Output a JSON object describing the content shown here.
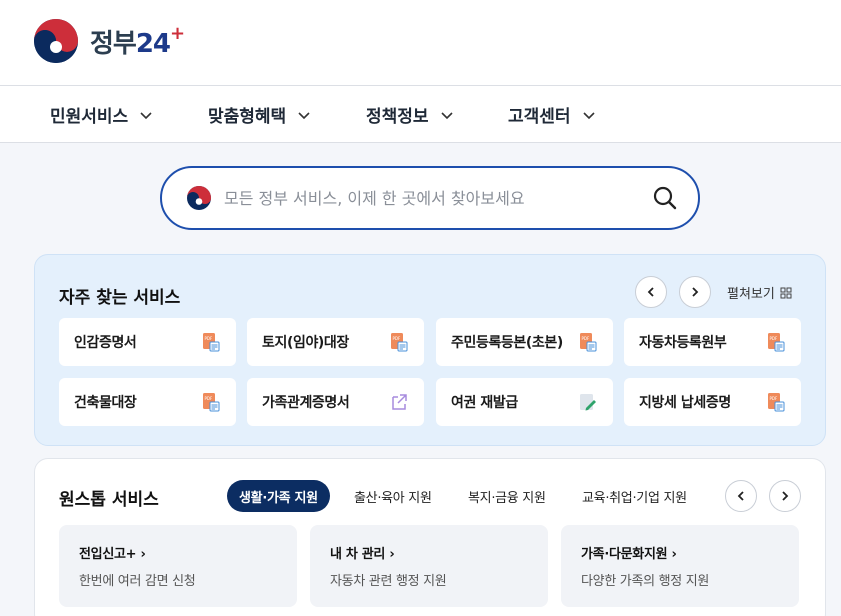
{
  "header": {
    "logo_text": "정부",
    "logo_num": "24",
    "logo_plus": "+"
  },
  "nav": {
    "items": [
      {
        "label": "민원서비스"
      },
      {
        "label": "맞춤형혜택"
      },
      {
        "label": "정책정보"
      },
      {
        "label": "고객센터"
      }
    ]
  },
  "search": {
    "placeholder": "모든 정부 서비스, 이제 한 곳에서 찾아보세요",
    "value": ""
  },
  "frequent": {
    "title": "자주 찾는 서비스",
    "expand_label": "펼쳐보기",
    "services": [
      {
        "label": "인감증명서",
        "icon": "pdf-doc-icon"
      },
      {
        "label": "토지(임야)대장",
        "icon": "pdf-doc-icon"
      },
      {
        "label": "주민등록등본(초본)",
        "icon": "pdf-doc-icon"
      },
      {
        "label": "자동차등록원부",
        "icon": "pdf-doc-icon"
      },
      {
        "label": "건축물대장",
        "icon": "pdf-doc-icon"
      },
      {
        "label": "가족관계증명서",
        "icon": "external-link-icon"
      },
      {
        "label": "여권 재발급",
        "icon": "edit-doc-icon"
      },
      {
        "label": "지방세 납세증명",
        "icon": "pdf-doc-icon"
      }
    ]
  },
  "onestop": {
    "title": "원스톱 서비스",
    "tabs": [
      {
        "label": "생활·가족 지원",
        "active": true
      },
      {
        "label": "출산·육아 지원"
      },
      {
        "label": "복지·금융 지원"
      },
      {
        "label": "교육·취업·기업 지원"
      }
    ],
    "cards": [
      {
        "title": "전입신고+ ›",
        "desc": "한번에 여러 감면 신청"
      },
      {
        "title": "내 차 관리 ›",
        "desc": "자동차 관련 행정 지원"
      },
      {
        "title": "가족·다문화지원 ›",
        "desc": "다양한 가족의 행정 지원"
      }
    ]
  },
  "colors": {
    "primary": "#1e4fad",
    "navy": "#0c2d62",
    "panel": "#e4f0fc",
    "emblem_red": "#cd2e3a",
    "emblem_blue": "#0047a0"
  }
}
